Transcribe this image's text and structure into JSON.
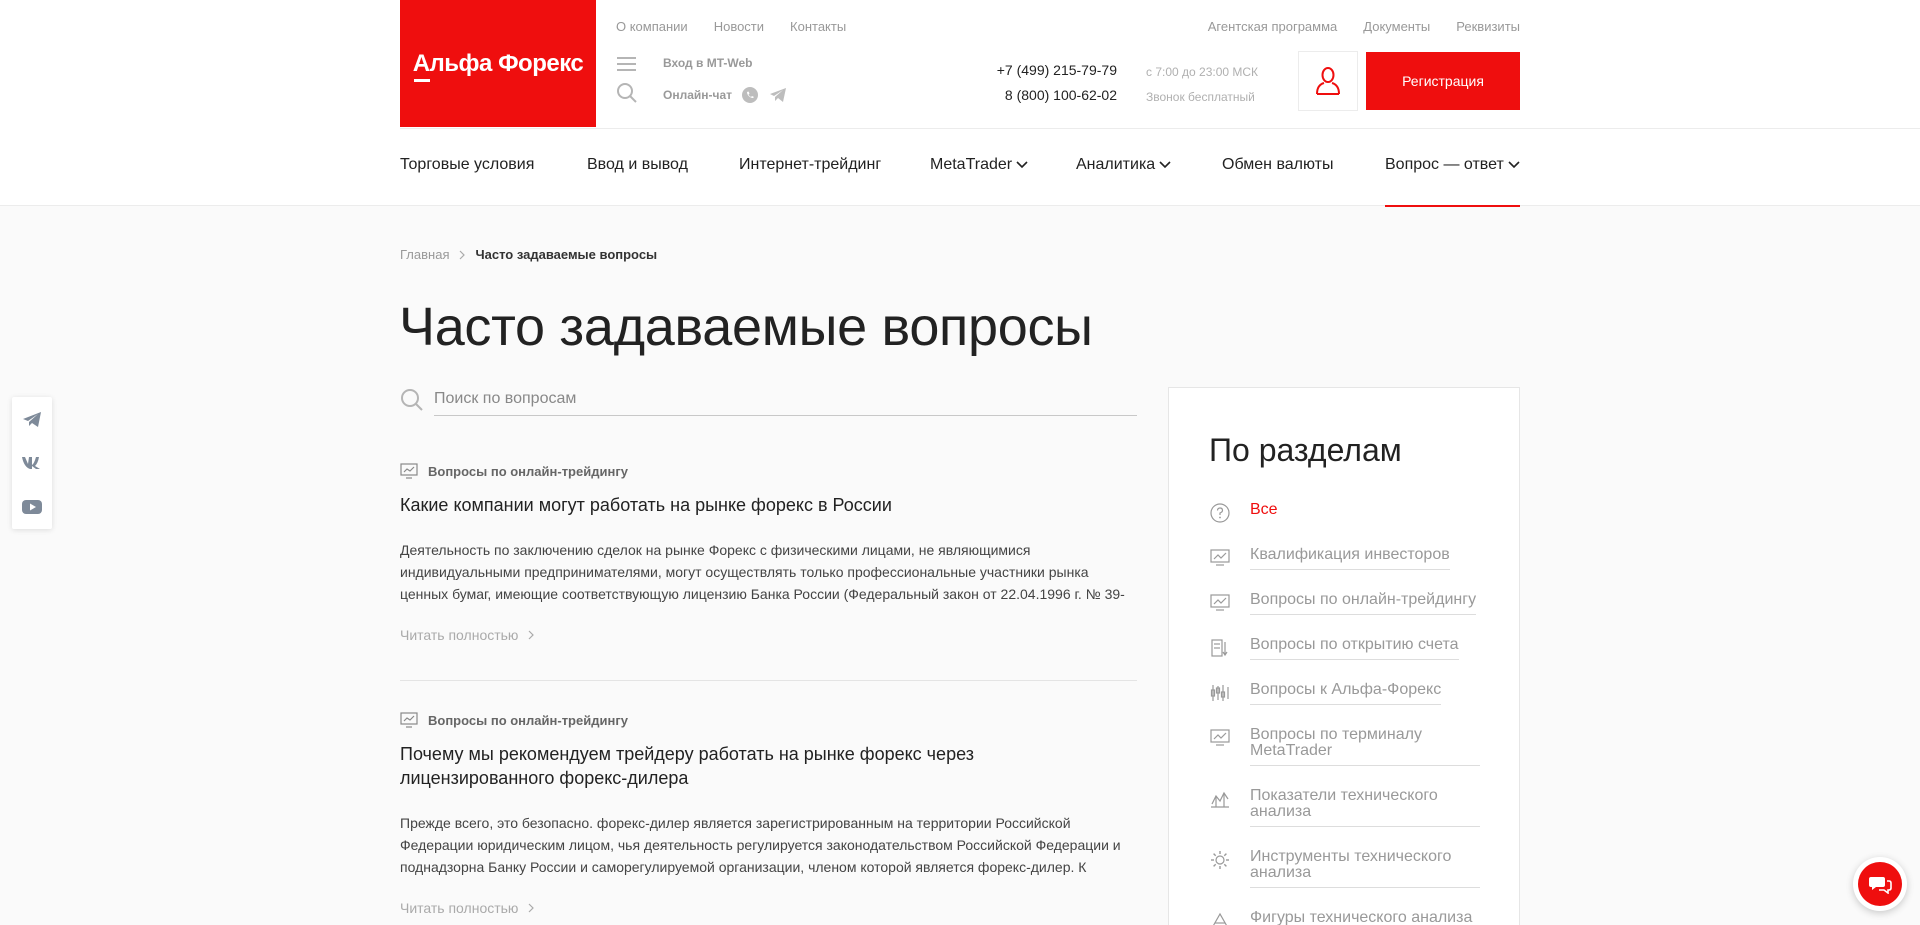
{
  "header": {
    "logo_text": "Альфа Форекс",
    "top_left_links": [
      "О компании",
      "Новости",
      "Контакты"
    ],
    "top_right_links": [
      "Агентская программа",
      "Документы",
      "Реквизиты"
    ],
    "mt_web": "Вход в MT-Web",
    "online_chat": "Онлайн-чат",
    "phone_1": "+7 (499) 215-79-79",
    "phone_2": "8 (800) 100-62-02",
    "hours": "с 7:00 до 23:00 МСК",
    "call_free": "Звонок бесплатный",
    "register_label": "Регистрация"
  },
  "main_nav": [
    {
      "label": "Торговые условия",
      "dropdown": false
    },
    {
      "label": "Ввод и вывод",
      "dropdown": false
    },
    {
      "label": "Интернет-трейдинг",
      "dropdown": false
    },
    {
      "label": "MetaTrader",
      "dropdown": true
    },
    {
      "label": "Аналитика",
      "dropdown": true
    },
    {
      "label": "Обмен валюты",
      "dropdown": false
    },
    {
      "label": "Вопрос — ответ",
      "dropdown": true,
      "active": true
    }
  ],
  "breadcrumb": {
    "home": "Главная",
    "current": "Часто задаваемые вопросы"
  },
  "page_title": "Часто задаваемые вопросы",
  "search": {
    "placeholder": "Поиск по вопросам",
    "value": ""
  },
  "articles": [
    {
      "category": "Вопросы по онлайн-трейдингу",
      "title": "Какие компании могут работать на рынке форекс в России",
      "excerpt": "Деятельность по заключению сделок на рынке Форекс с физическими лицами, не являющимися индивидуальными предпринимателями, могут осуществлять только профессиональные участники рынка ценных бумаг, имеющие соответствующую лицензию Банка России (Федеральный закон от 22.04.1996 г. № 39-",
      "more": "Читать полностью"
    },
    {
      "category": "Вопросы по онлайн-трейдингу",
      "title": "Почему мы рекомендуем трейдеру работать на рынке форекс через лицензированного форекс-дилера",
      "excerpt": "Прежде всего, это безопасно. форекс-дилер является зарегистрированным на территории Российской Федерации юридическим лицом, чья деятельность регулируется законодательством Российской Федерации и поднадзорна Банку России и саморегулируемой организации, членом которой является форекс-дилер. К",
      "more": "Читать полностью"
    }
  ],
  "sidebar": {
    "title": "По разделам",
    "items": [
      {
        "label": "Все",
        "icon": "question-icon",
        "active": true
      },
      {
        "label": "Квалификация инвесторов",
        "icon": "monitor-chart-icon"
      },
      {
        "label": "Вопросы по онлайн-трейдингу",
        "icon": "monitor-chart-icon"
      },
      {
        "label": "Вопросы по открытию счета",
        "icon": "document-icon"
      },
      {
        "label": "Вопросы к Альфа-Форекс",
        "icon": "candles-icon"
      },
      {
        "label": "Вопросы по терминалу MetaTrader",
        "icon": "monitor-chart-icon"
      },
      {
        "label": "Показатели технического анализа",
        "icon": "chart-icon"
      },
      {
        "label": "Инструменты технического анализа",
        "icon": "gear-icon"
      },
      {
        "label": "Фигуры технического анализа",
        "icon": "triangle-icon"
      }
    ]
  },
  "colors": {
    "accent": "#ef0e0e",
    "text": "#222222",
    "muted": "#999999"
  }
}
